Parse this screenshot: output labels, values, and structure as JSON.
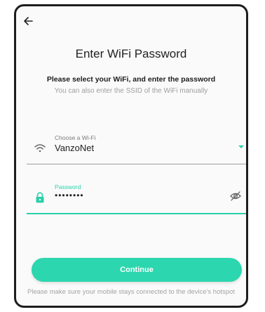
{
  "header": {
    "back_icon": "arrow-left-icon",
    "title": "Enter WiFi Password",
    "subtitle": "Please select your WiFi, and enter the password",
    "hint": "You can also enter the SSID of the WiFi manually"
  },
  "wifi_field": {
    "icon": "wifi-icon",
    "label": "Choose a Wi-Fi",
    "value": "VanzoNet"
  },
  "password_field": {
    "icon": "lock-icon",
    "label": "Password",
    "value": "••••••••",
    "toggle_icon": "eye-off-icon"
  },
  "continue_button": {
    "label": "Continue"
  },
  "footnote": "Please make sure your mobile stays connected to the device's hotspot",
  "colors": {
    "accent": "#2ccfa9",
    "button": "#2cd6ae",
    "muted_text": "#9e9e9e"
  }
}
